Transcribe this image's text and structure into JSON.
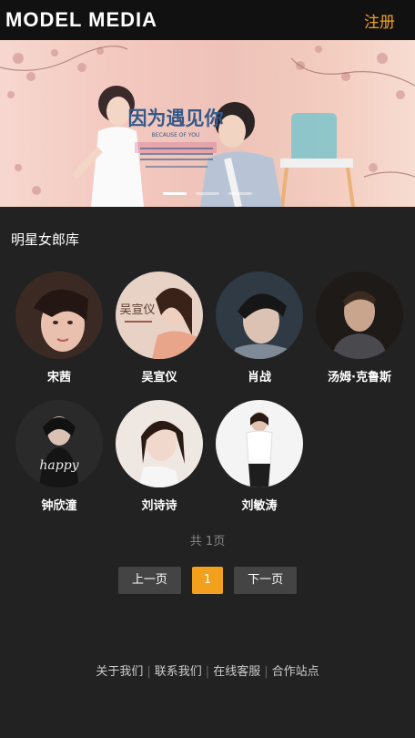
{
  "header": {
    "logo": "MODEL MEDIA",
    "register": "注册"
  },
  "banner": {
    "title": "因为遇见你",
    "slides": 3,
    "active_slide": 0
  },
  "section": {
    "title": "明星女郎库"
  },
  "stars": [
    {
      "name": "宋茜",
      "tone": "#c99a86"
    },
    {
      "name": "吴宣仪",
      "tone": "#d8b09c",
      "poster_text": "吴宣仪"
    },
    {
      "name": "肖战",
      "tone": "#9aa7b3"
    },
    {
      "name": "汤姆·克鲁斯",
      "tone": "#8a7868"
    },
    {
      "name": "钟欣潼",
      "tone": "#3a3a3a",
      "poster_text": "happy"
    },
    {
      "name": "刘诗诗",
      "tone": "#e7d9d0"
    },
    {
      "name": "刘敏涛",
      "tone": "#f1f1f1"
    }
  ],
  "pagination": {
    "total_text": "共 1页",
    "prev": "上一页",
    "current": "1",
    "next": "下一页"
  },
  "footer": {
    "links": [
      "关于我们",
      "联系我们",
      "在线客服",
      "合作站点"
    ]
  },
  "colors": {
    "accent": "#f3a01c",
    "background": "#222222",
    "header": "#111111"
  }
}
